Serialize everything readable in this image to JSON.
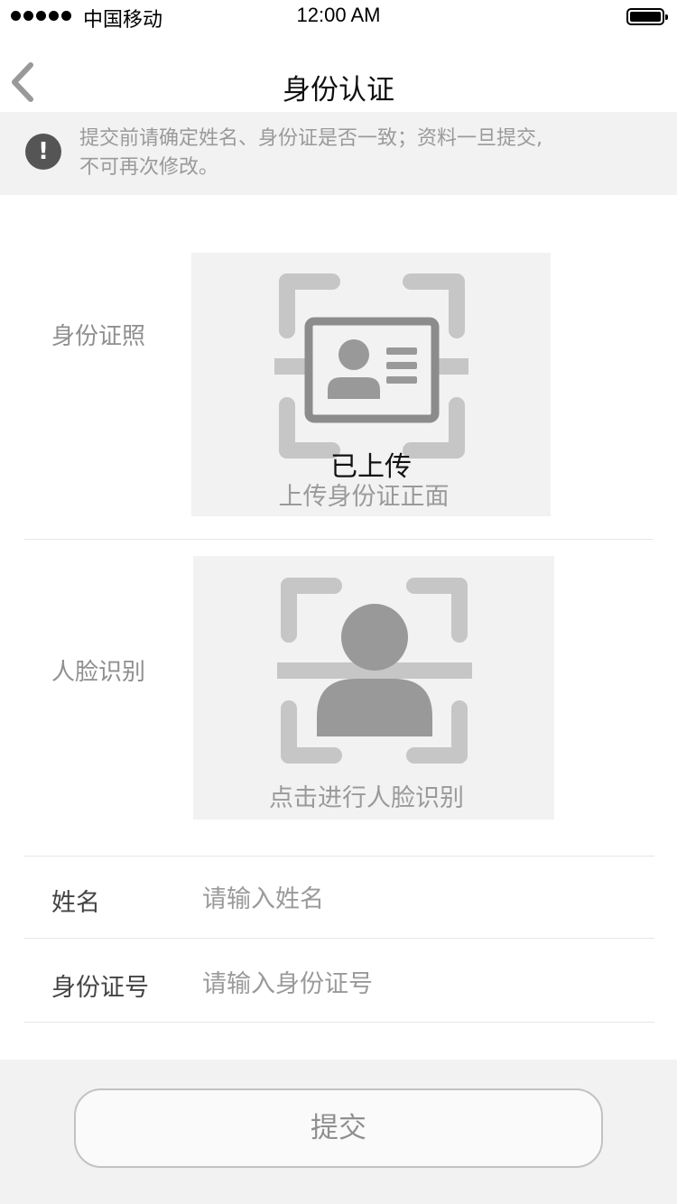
{
  "status_bar": {
    "carrier": "中国移动",
    "time": "12:00 AM",
    "signal_bars": 5,
    "battery_level": 1.0
  },
  "nav": {
    "title": "身份认证",
    "back_icon": "chevron-left-icon"
  },
  "notice": {
    "icon": "exclamation-icon",
    "symbol": "!",
    "line1": "提交前请确定姓名、身份证是否一致；资料一旦提交,",
    "line2": "不可再次修改。"
  },
  "id_photo": {
    "label": "身份证照",
    "status": "已上传",
    "caption": "上传身份证正面",
    "icon": "id-card-scan-icon"
  },
  "face": {
    "label": "人脸识别",
    "caption": "点击进行人脸识别",
    "icon": "face-scan-icon"
  },
  "form": {
    "name_label": "姓名",
    "name_placeholder": "请输入姓名",
    "name_value": "",
    "id_label": "身份证号",
    "id_placeholder": "请输入身份证号",
    "id_value": ""
  },
  "footer": {
    "submit_label": "提交"
  },
  "colors": {
    "panel_bg": "#f2f2f2",
    "icon_dark": "#999999",
    "icon_light": "#c6c6c6",
    "muted_text": "#9a9a9a"
  }
}
